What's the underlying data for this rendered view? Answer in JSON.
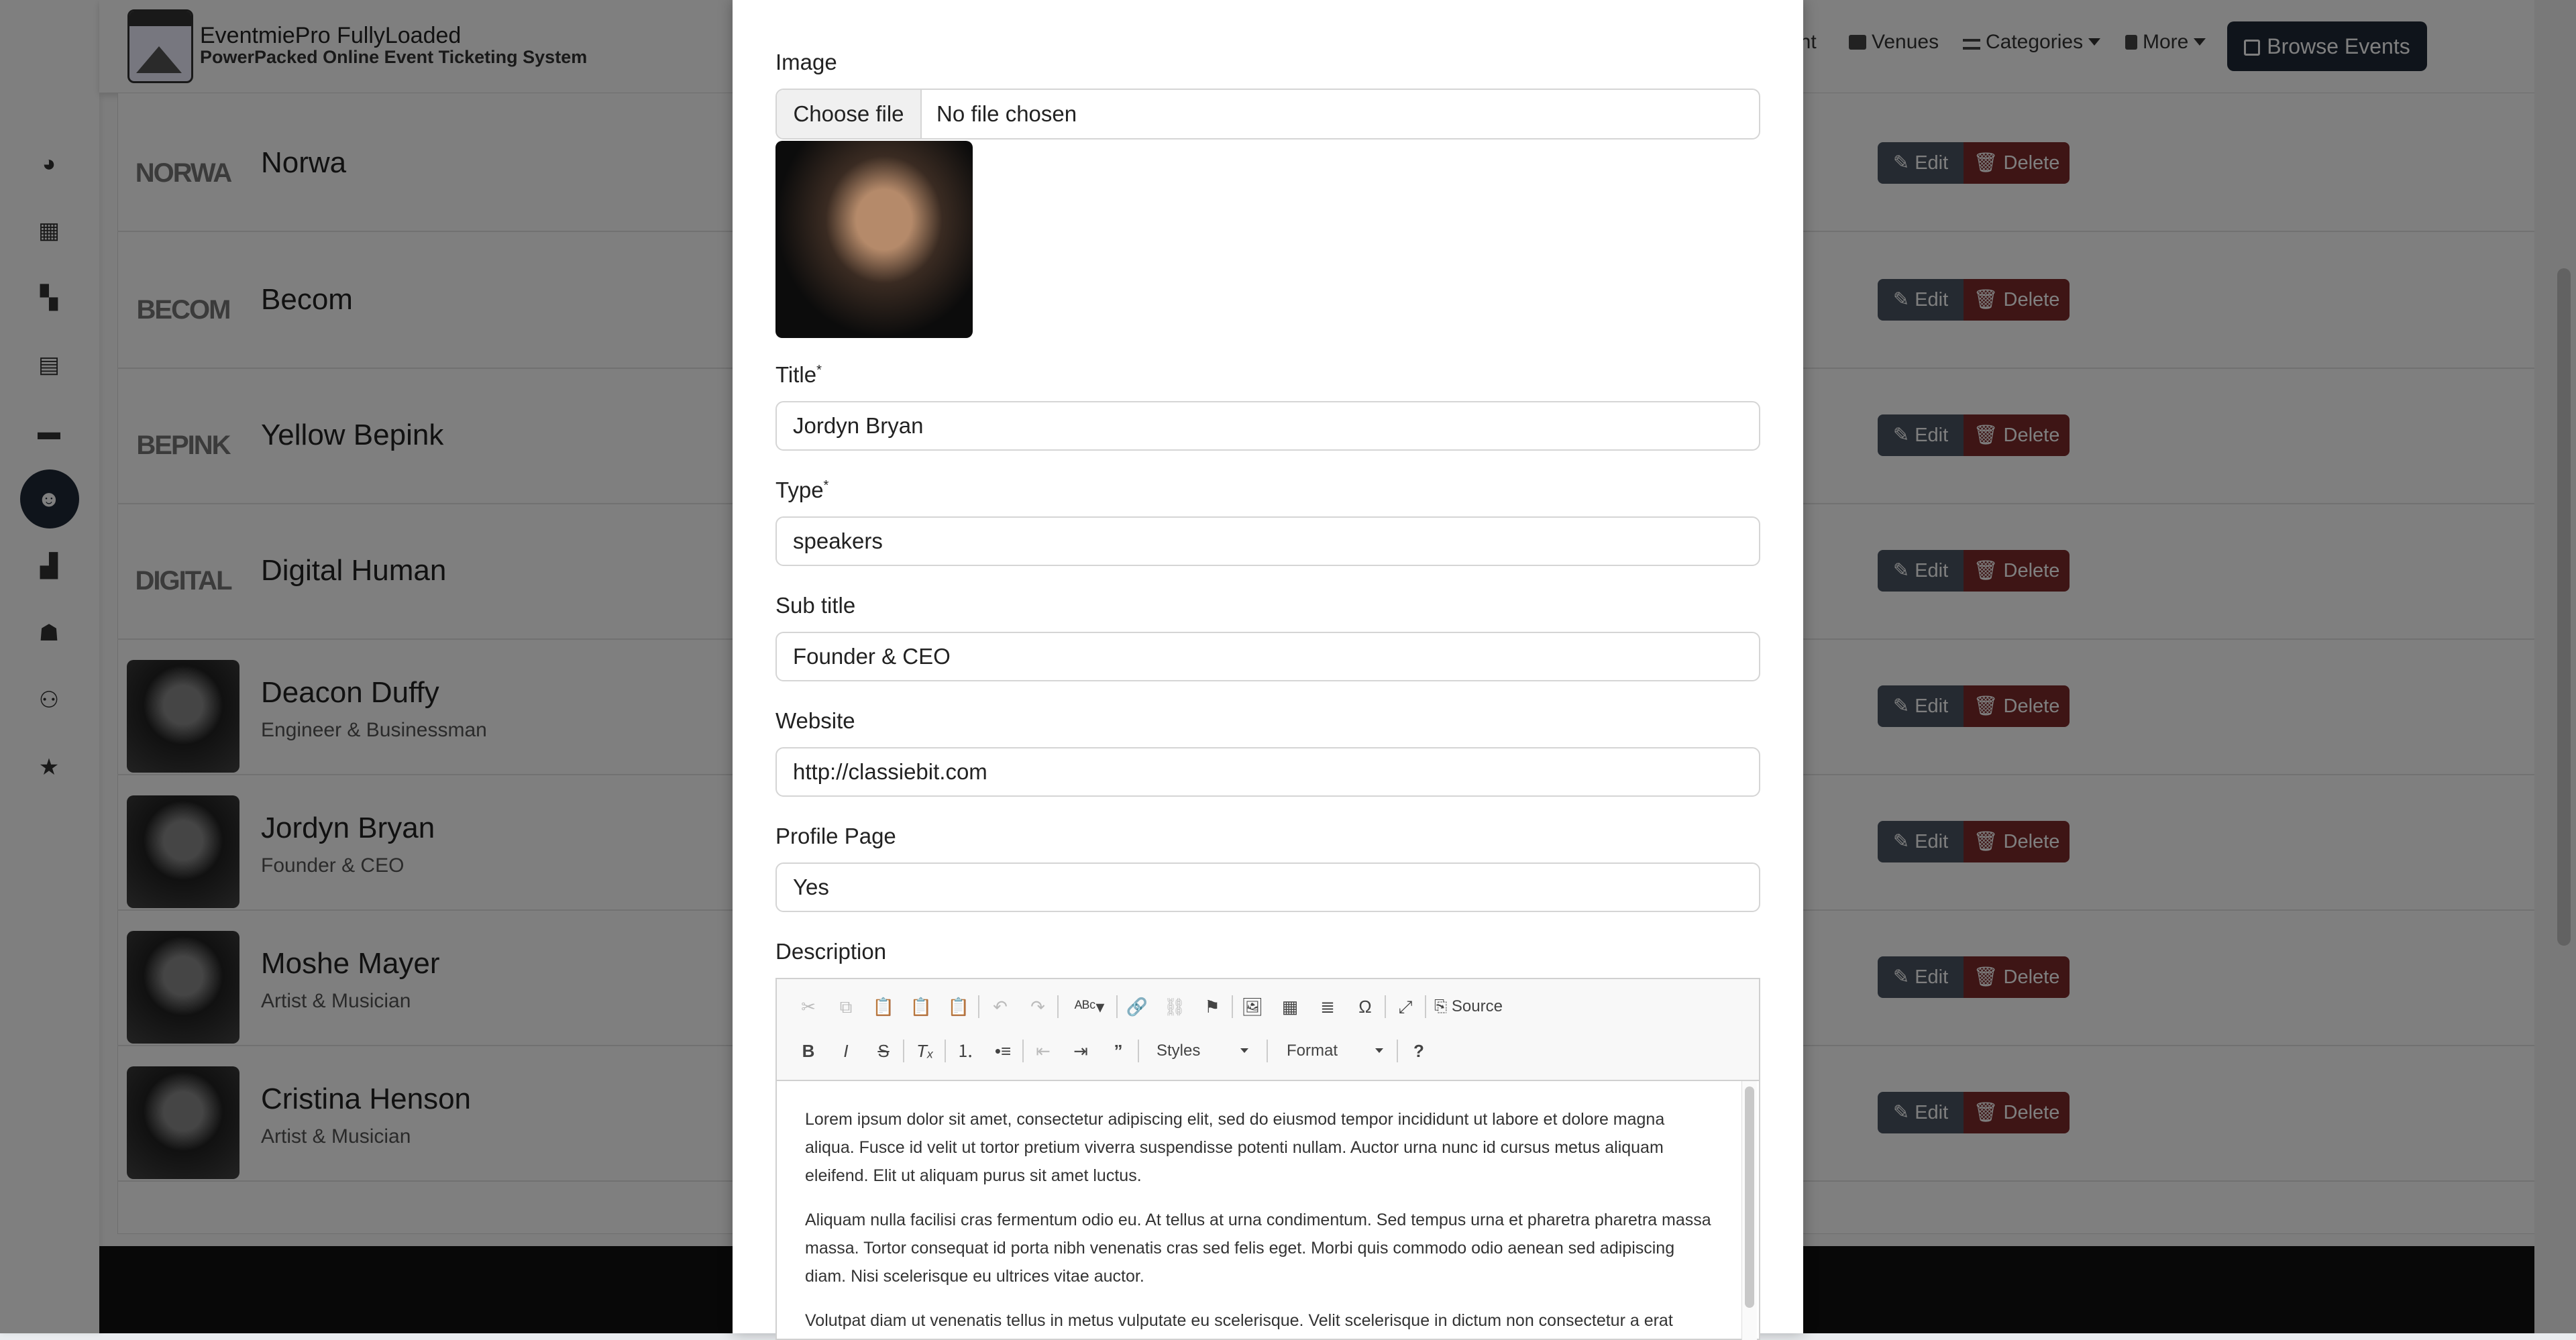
{
  "brand": {
    "title": "EventmiePro FullyLoaded",
    "subtitle": "PowerPacked Online Event Ticketing System"
  },
  "nav": {
    "partial": "ent",
    "venues": "Venues",
    "categories": "Categories",
    "more": "More",
    "browse": "Browse Events"
  },
  "sidebar_icons": [
    "dashboard-icon",
    "calendar-icon",
    "grid-icon",
    "ticket-icon",
    "wallet-icon",
    "performers-icon",
    "map-icon",
    "users-icon",
    "team-icon",
    "star-icon"
  ],
  "list": {
    "edit_label": "Edit",
    "delete_label": "Delete",
    "rows": [
      {
        "name": "Norwa",
        "sub": "",
        "logo": "NORWA"
      },
      {
        "name": "Becom",
        "sub": "",
        "logo": "BECOM"
      },
      {
        "name": "Yellow Bepink",
        "sub": "",
        "logo": "BEPINK"
      },
      {
        "name": "Digital Human",
        "sub": "",
        "logo": "DIGITAL"
      },
      {
        "name": "Deacon Duffy",
        "sub": "Engineer & Businessman",
        "logo": ""
      },
      {
        "name": "Jordyn Bryan",
        "sub": "Founder & CEO",
        "logo": ""
      },
      {
        "name": "Moshe Mayer",
        "sub": "Artist & Musician",
        "logo": ""
      },
      {
        "name": "Cristina Henson",
        "sub": "Artist & Musician",
        "logo": ""
      }
    ]
  },
  "form": {
    "image_label": "Image",
    "choose_file": "Choose file",
    "no_file": "No file chosen",
    "title_label": "Title",
    "title_value": "Jordyn Bryan",
    "type_label": "Type",
    "type_value": "speakers",
    "subtitle_label": "Sub title",
    "subtitle_value": "Founder & CEO",
    "website_label": "Website",
    "website_value": "http://classiebit.com",
    "profile_label": "Profile Page",
    "profile_value": "Yes",
    "description_label": "Description",
    "required_mark": "*"
  },
  "editor": {
    "source_label": "Source",
    "styles_label": "Styles",
    "format_label": "Format",
    "paragraphs": [
      "Lorem ipsum dolor sit amet, consectetur adipiscing elit, sed do eiusmod tempor incididunt ut labore et dolore magna aliqua. Fusce id velit ut tortor pretium viverra suspendisse potenti nullam. Auctor urna nunc id cursus metus aliquam eleifend. Elit ut aliquam purus sit amet luctus.",
      "Aliquam nulla facilisi cras fermentum odio eu. At tellus at urna condimentum. Sed tempus urna et pharetra pharetra massa massa. Tortor consequat id porta nibh venenatis cras sed felis eget. Morbi quis commodo odio aenean sed adipiscing diam. Nisi scelerisque eu ultrices vitae auctor.",
      "Volutpat diam ut venenatis tellus in metus vulputate eu scelerisque. Velit scelerisque in dictum non consectetur a erat"
    ]
  }
}
